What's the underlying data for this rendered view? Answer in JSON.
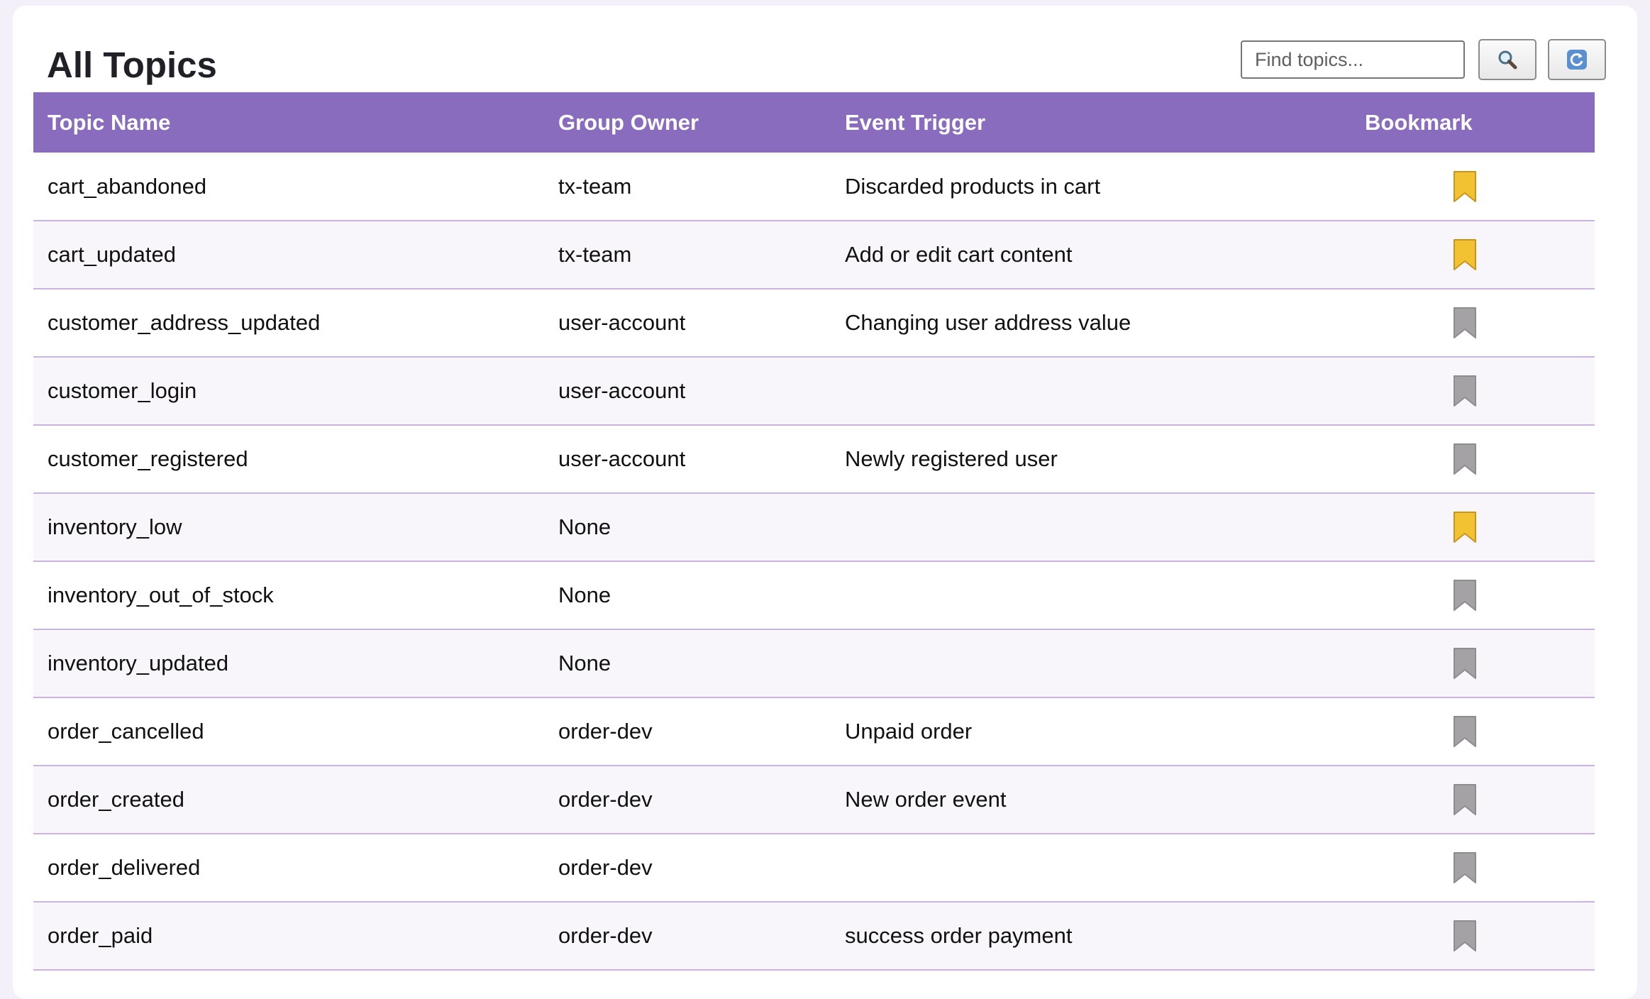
{
  "page": {
    "title": "All Topics"
  },
  "toolbar": {
    "search_placeholder": "Find topics...",
    "search_value": "",
    "search_icon": "magnifier-icon",
    "refresh_icon": "refresh-icon"
  },
  "table": {
    "headers": {
      "topic_name": "Topic Name",
      "group_owner": "Group Owner",
      "event_trigger": "Event Trigger",
      "bookmark": "Bookmark"
    },
    "rows": [
      {
        "topic": "cart_abandoned",
        "owner": "tx-team",
        "trigger": "Discarded products in cart",
        "bookmarked": true
      },
      {
        "topic": "cart_updated",
        "owner": "tx-team",
        "trigger": "Add or edit cart content",
        "bookmarked": true
      },
      {
        "topic": "customer_address_updated",
        "owner": "user-account",
        "trigger": "Changing user address value",
        "bookmarked": false
      },
      {
        "topic": "customer_login",
        "owner": "user-account",
        "trigger": "",
        "bookmarked": false
      },
      {
        "topic": "customer_registered",
        "owner": "user-account",
        "trigger": "Newly registered user",
        "bookmarked": false
      },
      {
        "topic": "inventory_low",
        "owner": "None",
        "trigger": "",
        "bookmarked": true
      },
      {
        "topic": "inventory_out_of_stock",
        "owner": "None",
        "trigger": "",
        "bookmarked": false
      },
      {
        "topic": "inventory_updated",
        "owner": "None",
        "trigger": "",
        "bookmarked": false
      },
      {
        "topic": "order_cancelled",
        "owner": "order-dev",
        "trigger": "Unpaid order",
        "bookmarked": false
      },
      {
        "topic": "order_created",
        "owner": "order-dev",
        "trigger": "New order event",
        "bookmarked": false
      },
      {
        "topic": "order_delivered",
        "owner": "order-dev",
        "trigger": "",
        "bookmarked": false
      },
      {
        "topic": "order_paid",
        "owner": "order-dev",
        "trigger": "success order payment",
        "bookmarked": false
      }
    ]
  },
  "colors": {
    "header_bg": "#8a6cbe",
    "bookmark_on": "#f2c232",
    "bookmark_off": "#a4a2a4",
    "row_divider": "#c9b4e0"
  }
}
